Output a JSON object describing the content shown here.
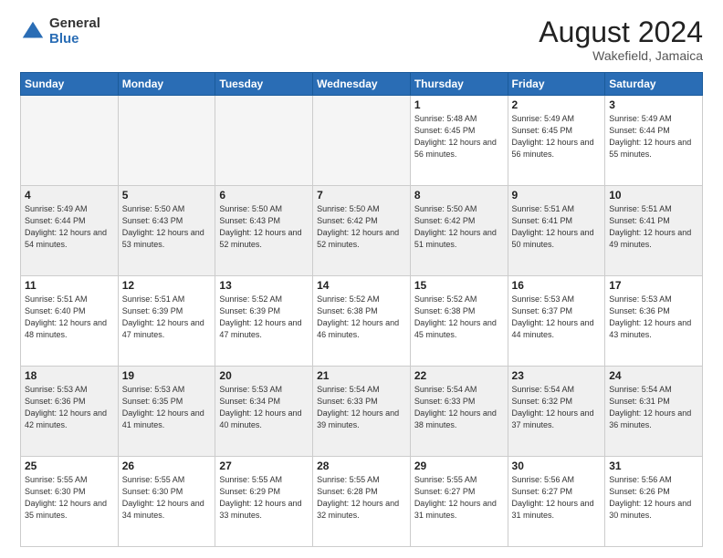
{
  "header": {
    "logo_general": "General",
    "logo_blue": "Blue",
    "title": "August 2024",
    "location": "Wakefield, Jamaica"
  },
  "days_of_week": [
    "Sunday",
    "Monday",
    "Tuesday",
    "Wednesday",
    "Thursday",
    "Friday",
    "Saturday"
  ],
  "weeks": [
    [
      {
        "day": "",
        "empty": true
      },
      {
        "day": "",
        "empty": true
      },
      {
        "day": "",
        "empty": true
      },
      {
        "day": "",
        "empty": true
      },
      {
        "day": "1",
        "info": "Sunrise: 5:48 AM\nSunset: 6:45 PM\nDaylight: 12 hours\nand 56 minutes."
      },
      {
        "day": "2",
        "info": "Sunrise: 5:49 AM\nSunset: 6:45 PM\nDaylight: 12 hours\nand 56 minutes."
      },
      {
        "day": "3",
        "info": "Sunrise: 5:49 AM\nSunset: 6:44 PM\nDaylight: 12 hours\nand 55 minutes."
      }
    ],
    [
      {
        "day": "4",
        "info": "Sunrise: 5:49 AM\nSunset: 6:44 PM\nDaylight: 12 hours\nand 54 minutes."
      },
      {
        "day": "5",
        "info": "Sunrise: 5:50 AM\nSunset: 6:43 PM\nDaylight: 12 hours\nand 53 minutes."
      },
      {
        "day": "6",
        "info": "Sunrise: 5:50 AM\nSunset: 6:43 PM\nDaylight: 12 hours\nand 52 minutes."
      },
      {
        "day": "7",
        "info": "Sunrise: 5:50 AM\nSunset: 6:42 PM\nDaylight: 12 hours\nand 52 minutes."
      },
      {
        "day": "8",
        "info": "Sunrise: 5:50 AM\nSunset: 6:42 PM\nDaylight: 12 hours\nand 51 minutes."
      },
      {
        "day": "9",
        "info": "Sunrise: 5:51 AM\nSunset: 6:41 PM\nDaylight: 12 hours\nand 50 minutes."
      },
      {
        "day": "10",
        "info": "Sunrise: 5:51 AM\nSunset: 6:41 PM\nDaylight: 12 hours\nand 49 minutes."
      }
    ],
    [
      {
        "day": "11",
        "info": "Sunrise: 5:51 AM\nSunset: 6:40 PM\nDaylight: 12 hours\nand 48 minutes."
      },
      {
        "day": "12",
        "info": "Sunrise: 5:51 AM\nSunset: 6:39 PM\nDaylight: 12 hours\nand 47 minutes."
      },
      {
        "day": "13",
        "info": "Sunrise: 5:52 AM\nSunset: 6:39 PM\nDaylight: 12 hours\nand 47 minutes."
      },
      {
        "day": "14",
        "info": "Sunrise: 5:52 AM\nSunset: 6:38 PM\nDaylight: 12 hours\nand 46 minutes."
      },
      {
        "day": "15",
        "info": "Sunrise: 5:52 AM\nSunset: 6:38 PM\nDaylight: 12 hours\nand 45 minutes."
      },
      {
        "day": "16",
        "info": "Sunrise: 5:53 AM\nSunset: 6:37 PM\nDaylight: 12 hours\nand 44 minutes."
      },
      {
        "day": "17",
        "info": "Sunrise: 5:53 AM\nSunset: 6:36 PM\nDaylight: 12 hours\nand 43 minutes."
      }
    ],
    [
      {
        "day": "18",
        "info": "Sunrise: 5:53 AM\nSunset: 6:36 PM\nDaylight: 12 hours\nand 42 minutes."
      },
      {
        "day": "19",
        "info": "Sunrise: 5:53 AM\nSunset: 6:35 PM\nDaylight: 12 hours\nand 41 minutes."
      },
      {
        "day": "20",
        "info": "Sunrise: 5:53 AM\nSunset: 6:34 PM\nDaylight: 12 hours\nand 40 minutes."
      },
      {
        "day": "21",
        "info": "Sunrise: 5:54 AM\nSunset: 6:33 PM\nDaylight: 12 hours\nand 39 minutes."
      },
      {
        "day": "22",
        "info": "Sunrise: 5:54 AM\nSunset: 6:33 PM\nDaylight: 12 hours\nand 38 minutes."
      },
      {
        "day": "23",
        "info": "Sunrise: 5:54 AM\nSunset: 6:32 PM\nDaylight: 12 hours\nand 37 minutes."
      },
      {
        "day": "24",
        "info": "Sunrise: 5:54 AM\nSunset: 6:31 PM\nDaylight: 12 hours\nand 36 minutes."
      }
    ],
    [
      {
        "day": "25",
        "info": "Sunrise: 5:55 AM\nSunset: 6:30 PM\nDaylight: 12 hours\nand 35 minutes."
      },
      {
        "day": "26",
        "info": "Sunrise: 5:55 AM\nSunset: 6:30 PM\nDaylight: 12 hours\nand 34 minutes."
      },
      {
        "day": "27",
        "info": "Sunrise: 5:55 AM\nSunset: 6:29 PM\nDaylight: 12 hours\nand 33 minutes."
      },
      {
        "day": "28",
        "info": "Sunrise: 5:55 AM\nSunset: 6:28 PM\nDaylight: 12 hours\nand 32 minutes."
      },
      {
        "day": "29",
        "info": "Sunrise: 5:55 AM\nSunset: 6:27 PM\nDaylight: 12 hours\nand 31 minutes."
      },
      {
        "day": "30",
        "info": "Sunrise: 5:56 AM\nSunset: 6:27 PM\nDaylight: 12 hours\nand 31 minutes."
      },
      {
        "day": "31",
        "info": "Sunrise: 5:56 AM\nSunset: 6:26 PM\nDaylight: 12 hours\nand 30 minutes."
      }
    ]
  ]
}
